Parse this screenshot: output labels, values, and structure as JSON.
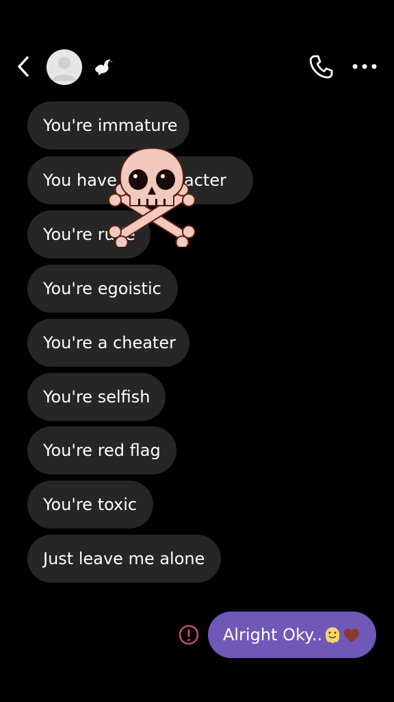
{
  "header": {
    "back_icon": "chevron-left-icon",
    "avatar_icon": "default-avatar-icon",
    "status_icon": "dove-icon",
    "call_icon": "phone-icon",
    "more_icon": "more-horizontal-icon"
  },
  "messages": [
    {
      "text": "You're immature"
    },
    {
      "text": "You have no character"
    },
    {
      "text": "You're rude"
    },
    {
      "text": "You're egoistic"
    },
    {
      "text": "You're a cheater"
    },
    {
      "text": "You're selfish"
    },
    {
      "text": "You're red flag"
    },
    {
      "text": "You're toxic"
    },
    {
      "text": "Just leave me alone"
    }
  ],
  "sent": {
    "text": "Alright Oky..",
    "emojis": [
      "melting-face-emoji",
      "brown-heart-emoji"
    ],
    "status_icon": "error-alert-icon",
    "bubble_color": "#6f58b8"
  },
  "sticker": "skull-and-crossbones-sticker",
  "colors": {
    "background": "#000000",
    "received_bubble": "#262626",
    "alert": "#c0506a"
  }
}
